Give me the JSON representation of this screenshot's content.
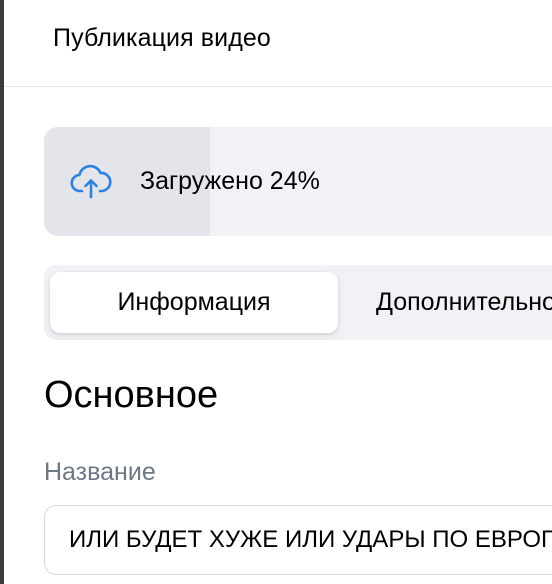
{
  "dialog": {
    "title": "Публикация видео"
  },
  "upload": {
    "status_text": "Загружено 24%",
    "progress_percent": 24,
    "icon": "cloud-upload-icon"
  },
  "tabs": [
    {
      "label": "Информация",
      "active": true
    },
    {
      "label": "Дополнительно",
      "active": false
    }
  ],
  "section": {
    "title": "Основное"
  },
  "fields": {
    "name": {
      "label": "Название",
      "value": "ИЛИ БУДЕТ ХУЖЕ ИЛИ УДАРЫ ПО ЕВРОПЕ"
    }
  },
  "colors": {
    "accent": "#2d81e0",
    "muted_text": "#6d7885",
    "card_bg": "#f0f2f5",
    "progress_fill": "#e3e5ea"
  }
}
